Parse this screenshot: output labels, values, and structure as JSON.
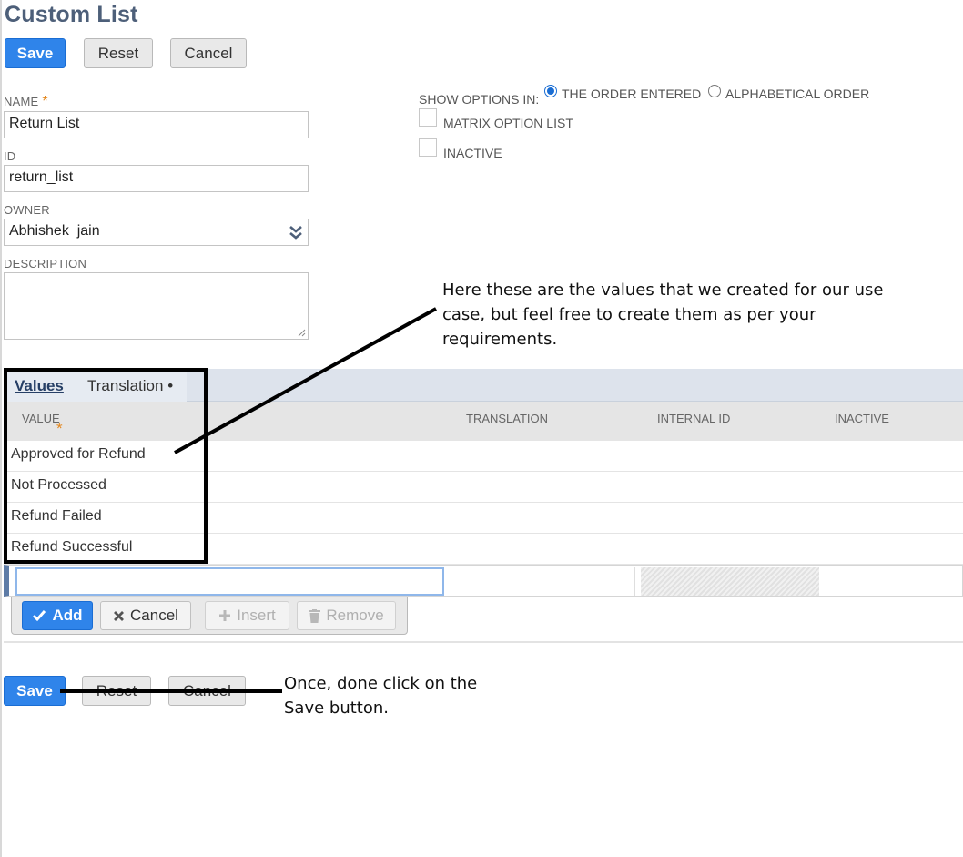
{
  "header": {
    "title": "Custom List"
  },
  "toolbar": {
    "save": "Save",
    "reset": "Reset",
    "cancel": "Cancel"
  },
  "form": {
    "name_label": "NAME",
    "name_required": "*",
    "name_value": "Return List",
    "id_label": "ID",
    "id_value": "return_list",
    "owner_label": "OWNER",
    "owner_value": "Abhishek  jain",
    "description_label": "DESCRIPTION",
    "description_value": ""
  },
  "options": {
    "show_options_label": "SHOW OPTIONS IN:",
    "order_entered": "THE ORDER ENTERED",
    "alphabetical": "ALPHABETICAL ORDER",
    "selected": "THE ORDER ENTERED",
    "matrix_option_list": "MATRIX OPTION LIST",
    "matrix_checked": false,
    "inactive": "INACTIVE",
    "inactive_checked": false
  },
  "tabs": {
    "values": "Values",
    "translation": "Translation",
    "translation_dot": "•"
  },
  "grid": {
    "headers": {
      "value": "VALUE",
      "value_required": "*",
      "translation": "TRANSLATION",
      "internal_id": "INTERNAL ID",
      "inactive": "INACTIVE"
    },
    "rows": [
      "Approved for Refund",
      "Not Processed",
      "Refund Failed",
      "Refund Successful"
    ],
    "new_value": ""
  },
  "line_buttons": {
    "add": "Add",
    "cancel": "Cancel",
    "insert": "Insert",
    "remove": "Remove"
  },
  "annotations": {
    "values_note_1": "Here these are the values that we created for our use",
    "values_note_2": "case, but feel free to create them as per your",
    "values_note_3": "requirements.",
    "save_note_1": "Once, done click on the",
    "save_note_2": "Save button."
  },
  "colors": {
    "primary": "#2f84ea",
    "title": "#4d5f79",
    "required": "#e3861c",
    "tab_strip": "#dde3ec"
  }
}
